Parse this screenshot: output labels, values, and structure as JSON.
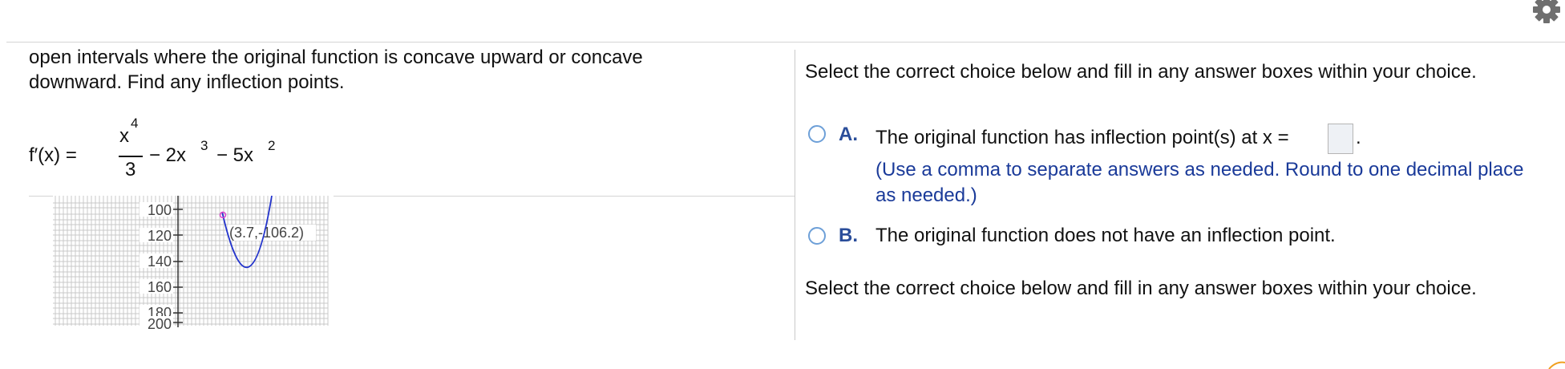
{
  "problem": {
    "intro_line1": "open intervals where the original function is concave upward or concave",
    "intro_line2": "downward. Find any inflection points.",
    "formula": {
      "lhs": "f′(x) =",
      "numerator": "x",
      "numerator_exp": "4",
      "denominator": "3",
      "term2": "− 2x",
      "term2_exp": "3",
      "term3": "− 5x",
      "term3_exp": "2"
    }
  },
  "graph": {
    "y_ticks": [
      "100",
      "120",
      "140",
      "160",
      "180",
      "200"
    ],
    "point_label": "(3.7,-106.2)",
    "curve_color": "#2233cc",
    "marker_color": "#dd44cc"
  },
  "right": {
    "prompt1": "Select the correct choice below and fill in any answer boxes within your choice.",
    "choice_a": {
      "letter": "A.",
      "text": "The original function has inflection point(s) at x =",
      "answer_value": "",
      "period": ".",
      "hint": "(Use a comma to separate answers as needed. Round to one decimal place as needed.)"
    },
    "choice_b": {
      "letter": "B.",
      "text": "The original function does not have an inflection point."
    },
    "prompt2": "Select the correct choice below and fill in any answer boxes within your choice."
  },
  "icons": {
    "settings": "gear-icon"
  }
}
